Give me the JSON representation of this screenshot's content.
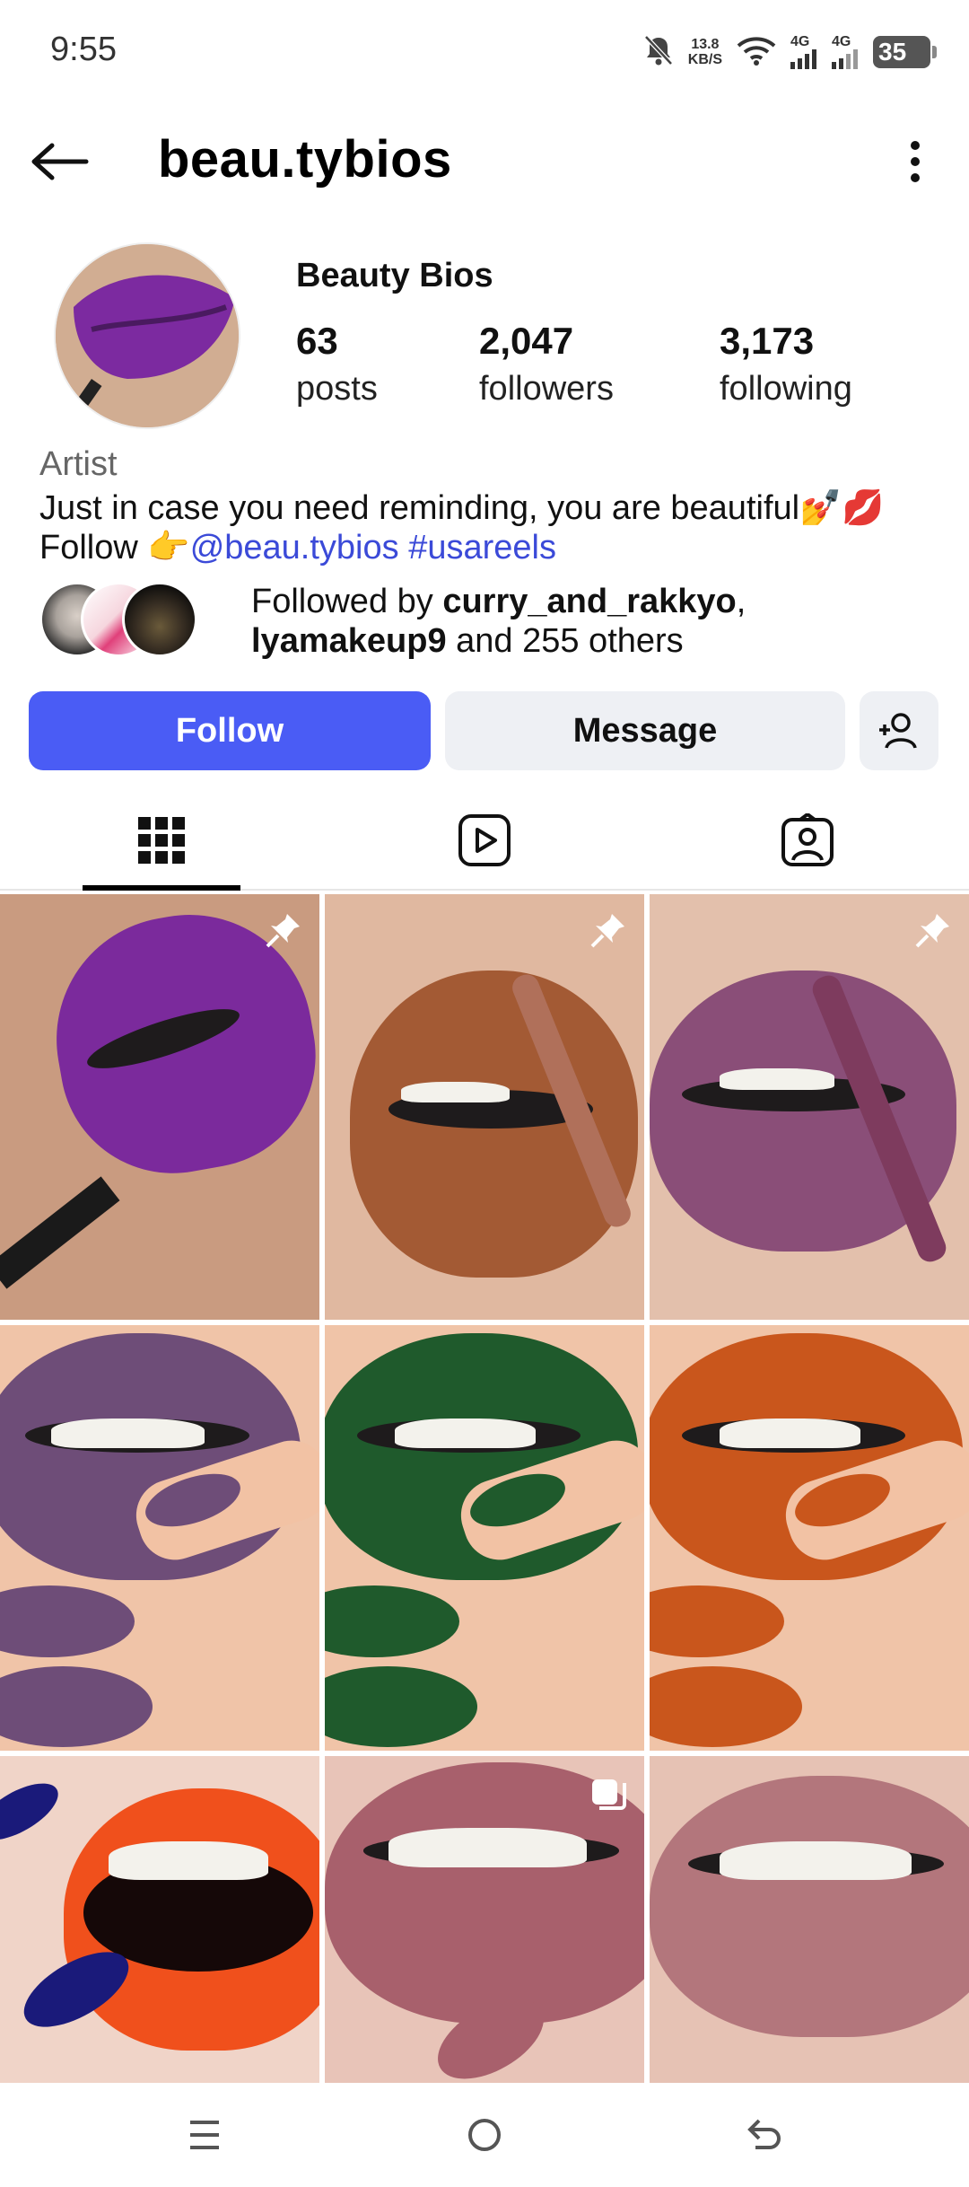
{
  "status_bar": {
    "time": "9:55",
    "net_speed_value": "13.8",
    "net_speed_unit": "KB/S",
    "signal1_label": "4G",
    "signal2_label": "4G",
    "battery": "35",
    "icons": [
      "bell-off-icon",
      "wifi-icon",
      "signal-icon",
      "signal-icon",
      "battery-icon"
    ]
  },
  "header": {
    "username": "beau.tybios",
    "back_icon": "arrow-left-icon",
    "more_icon": "more-vertical-icon"
  },
  "profile": {
    "display_name": "Beauty Bios",
    "stats": [
      {
        "value": "63",
        "label": "posts"
      },
      {
        "value": "2,047",
        "label": "followers"
      },
      {
        "value": "3,173",
        "label": "following"
      }
    ],
    "category": "Artist",
    "bio_line1": "Just in case you need reminding, you are beautiful💅💋",
    "bio_follow_prefix": "Follow 👉",
    "bio_mention": "@beau.tybios",
    "bio_hashtag": "#usareels",
    "followed_by_prefix": "Followed by ",
    "followed_by_user1": "curry_and_rakkyo",
    "followed_by_sep": ",",
    "followed_by_user2": "lyamakeup9",
    "followed_by_suffix": " and 255 others"
  },
  "actions": {
    "follow_label": "Follow",
    "message_label": "Message",
    "add_user_icon": "add-user-icon"
  },
  "tabs": [
    {
      "icon": "grid-icon",
      "selected": true
    },
    {
      "icon": "reels-icon",
      "selected": false
    },
    {
      "icon": "tagged-icon",
      "selected": false
    }
  ],
  "posts": [
    {
      "lip_color": "#7b2a9c",
      "skin": "#c99b80",
      "pinned": true
    },
    {
      "lip_color": "#a35a34",
      "skin": "#e0b8a0",
      "pinned": true
    },
    {
      "lip_color": "#8a4e78",
      "skin": "#e3c0ac",
      "pinned": true
    },
    {
      "lip_color": "#6e4d78",
      "skin": "#f0c4a8",
      "pinned": false
    },
    {
      "lip_color": "#1f5a2c",
      "skin": "#f0c4a8",
      "pinned": false
    },
    {
      "lip_color": "#c9561c",
      "skin": "#f0c4a8",
      "pinned": false
    },
    {
      "lip_color": "#f0501c",
      "skin": "#f0d4c8",
      "pinned": false
    },
    {
      "lip_color": "#a8606c",
      "skin": "#e8c4b8",
      "pinned": false,
      "carousel": true
    },
    {
      "lip_color": "#b3767c",
      "skin": "#e6c2b4",
      "pinned": false
    }
  ],
  "navbar": {
    "icons": [
      "menu-icon",
      "home-circle-icon",
      "back-gesture-icon"
    ]
  }
}
